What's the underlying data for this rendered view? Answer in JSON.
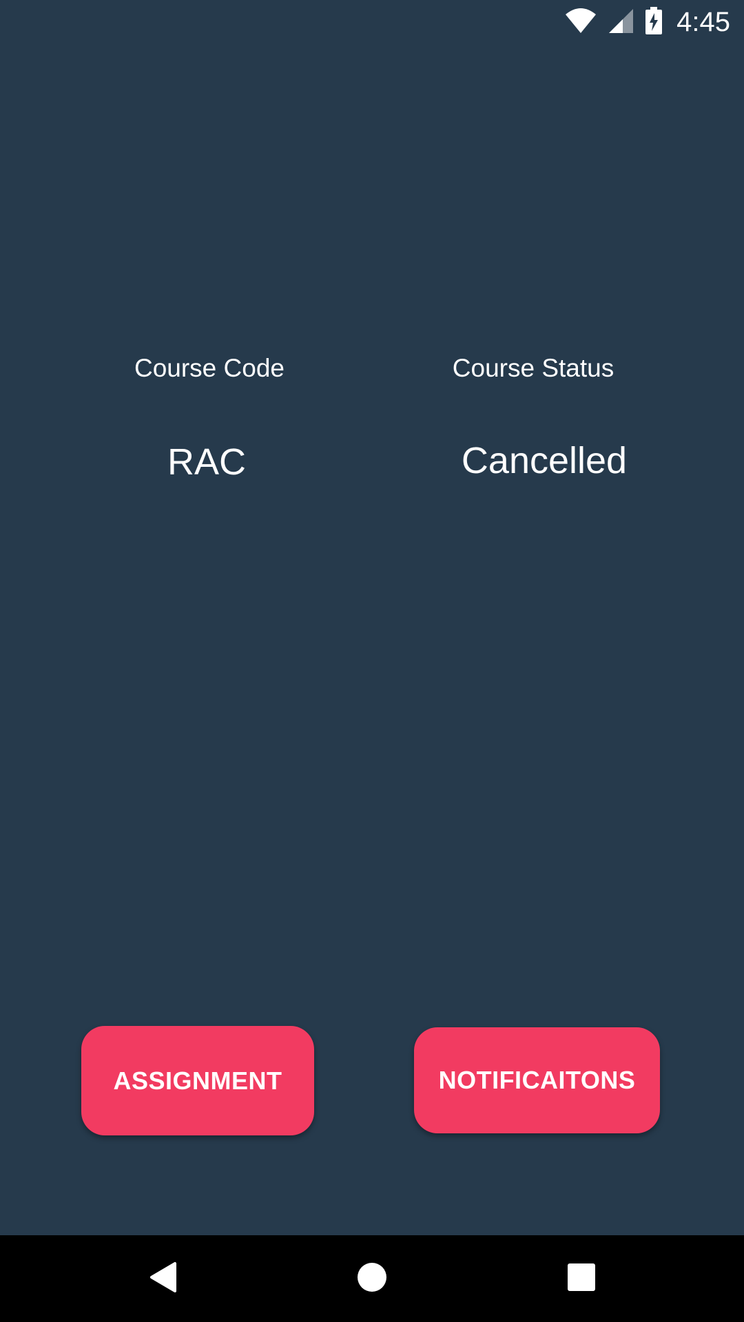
{
  "status_bar": {
    "time": "4:45",
    "icons": [
      "wifi-icon",
      "signal-icon",
      "battery-charging-icon"
    ]
  },
  "course": {
    "code_label": "Course Code",
    "code_value": "RAC",
    "status_label": "Course Status",
    "status_value": "Cancelled"
  },
  "actions": {
    "assignment_label": "ASSIGNMENT",
    "notifications_label": "NOTIFICAITONS"
  },
  "nav_bar": {
    "icons": [
      "back-icon",
      "home-icon",
      "recents-icon"
    ]
  },
  "colors": {
    "background": "#263a4c",
    "accent": "#f23b61",
    "nav_background": "#000000",
    "text": "#ffffff"
  }
}
